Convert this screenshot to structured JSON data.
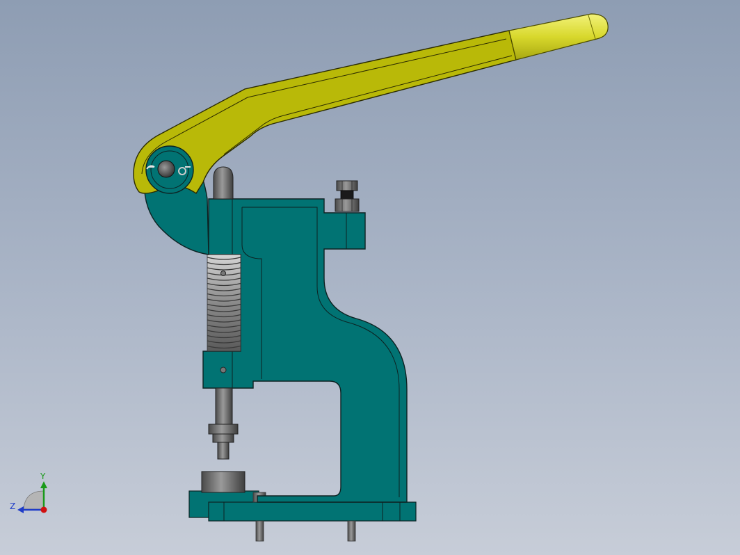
{
  "viewport": {
    "background_top": "#8e9db3",
    "background_bottom": "#c7cdd8"
  },
  "model": {
    "frame_color": "#017373",
    "handle_color": "#b9b908",
    "grip_color": "#e0e040",
    "metal_color": "#8c8c8c"
  },
  "triad": {
    "y_label": "Y",
    "z_label": "Z",
    "y_color": "#1a9a1a",
    "z_color": "#1f3cc8",
    "x_color": "#d01010"
  }
}
